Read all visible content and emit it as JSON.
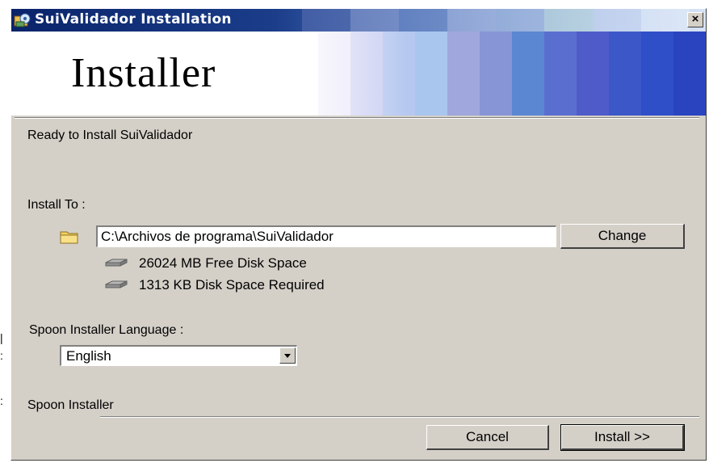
{
  "window": {
    "title": "SuiValidador Installation",
    "close_symbol": "×"
  },
  "banner": {
    "title": "Installer"
  },
  "content": {
    "heading": "Ready to Install SuiValidador",
    "install_to_label": "Install To :",
    "install_path": "C:\\Archivos de programa\\SuiValidador",
    "change_button": "Change",
    "free_space": "26024 MB Free Disk Space",
    "required_space": "1313 KB Disk Space Required",
    "language_label": "Spoon Installer Language :",
    "language_selected": "English"
  },
  "footer": {
    "brand": "Spoon Installer",
    "cancel_button": "Cancel",
    "install_button": "Install >>"
  },
  "icons": {
    "window_icon": "installer-icon",
    "folder": "folder-icon",
    "drive": "hard-drive-icon",
    "dropdown": "chevron-down-icon"
  },
  "colors": {
    "titlebar_start": "#0a246a",
    "titlebar_end": "#d6e2f6",
    "dialog_bg": "#d4d0c8"
  }
}
